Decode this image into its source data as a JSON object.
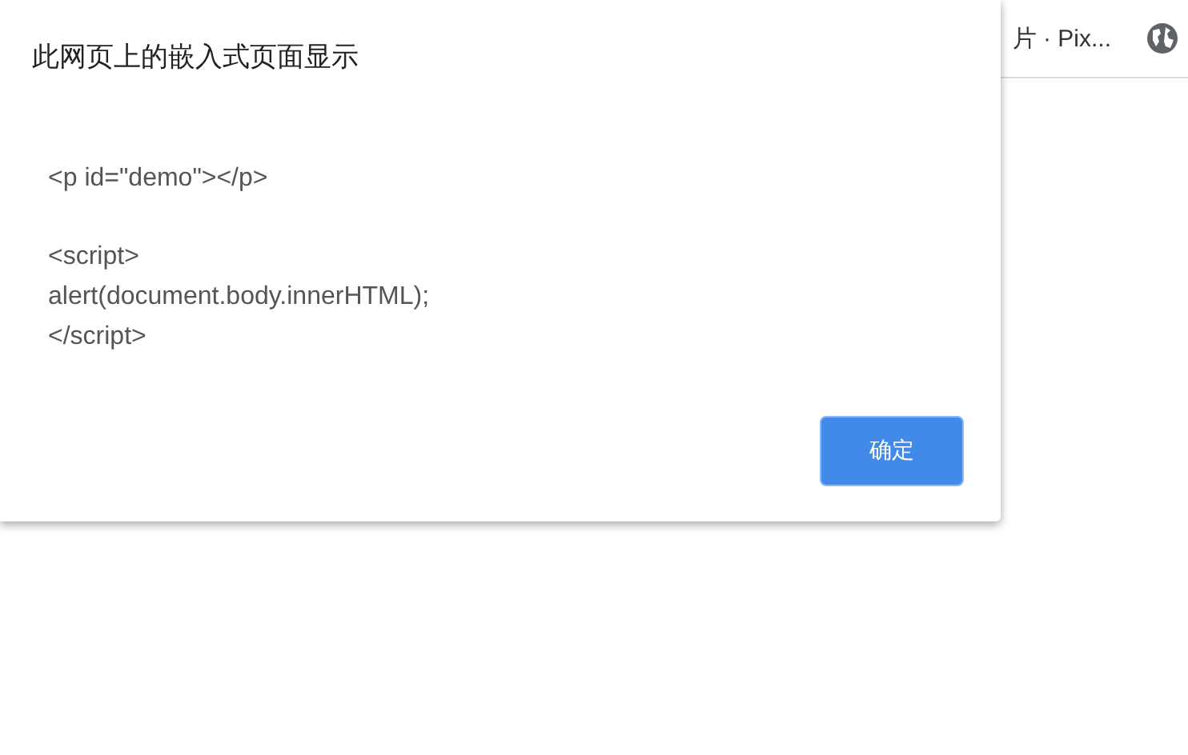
{
  "browser_tab": {
    "title": "片 · Pix..."
  },
  "dialog": {
    "title": "此网页上的嵌入式页面显示",
    "message_blocks": [
      [
        "<p id=\"demo\"></p>"
      ],
      [
        "<script>",
        "alert(document.body.innerHTML);",
        "</script>"
      ]
    ],
    "buttons": [
      {
        "label": "确定",
        "kind": "primary"
      }
    ]
  }
}
